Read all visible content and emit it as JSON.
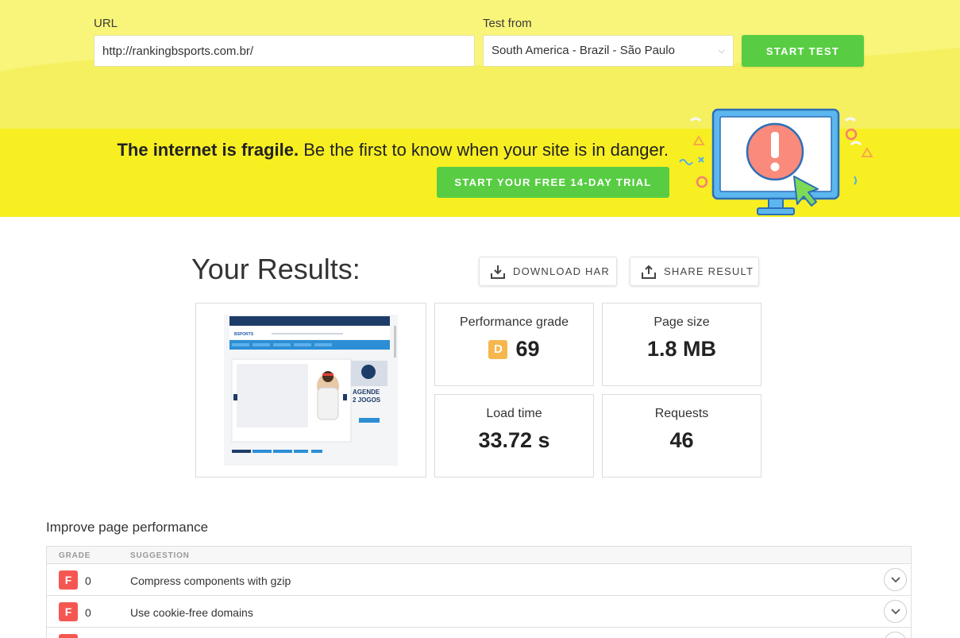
{
  "form": {
    "url_label": "URL",
    "url_value": "http://rankingbsports.com.br/",
    "location_label": "Test from",
    "location_value": "South America - Brazil - São Paulo",
    "start_button": "START TEST"
  },
  "banner": {
    "headline_bold": "The internet is fragile.",
    "headline_rest": " Be the first to know when your site is in danger.",
    "trial_button": "START YOUR FREE 14-DAY TRIAL"
  },
  "results": {
    "title": "Your Results:",
    "download_har": "DOWNLOAD HAR",
    "share_result": "SHARE RESULT",
    "performance_label": "Performance grade",
    "performance_grade": "D",
    "performance_score": "69",
    "page_size_label": "Page size",
    "page_size_value": "1.8 MB",
    "load_time_label": "Load time",
    "load_time_value": "33.72 s",
    "requests_label": "Requests",
    "requests_value": "46"
  },
  "screenshot": {
    "site_name": "BSPORTS",
    "promo_line1": "AGENDE",
    "promo_line2": "2 JOGOS"
  },
  "suggestions": {
    "title": "Improve page performance",
    "col_grade": "GRADE",
    "col_suggestion": "SUGGESTION",
    "rows": [
      {
        "grade": "F",
        "score": "0",
        "text": "Compress components with gzip"
      },
      {
        "grade": "F",
        "score": "0",
        "text": "Use cookie-free domains"
      },
      {
        "grade": "F",
        "score": "",
        "text": ""
      }
    ]
  },
  "colors": {
    "form_background": "#f5f060",
    "banner_background": "#f8ef22",
    "accent_green": "#58cd44",
    "grade_d": "#f5b74e",
    "grade_f": "#f45752"
  },
  "icons": [
    "chevron-down-icon",
    "download-icon",
    "share-icon",
    "alert-monitor-illustration"
  ]
}
